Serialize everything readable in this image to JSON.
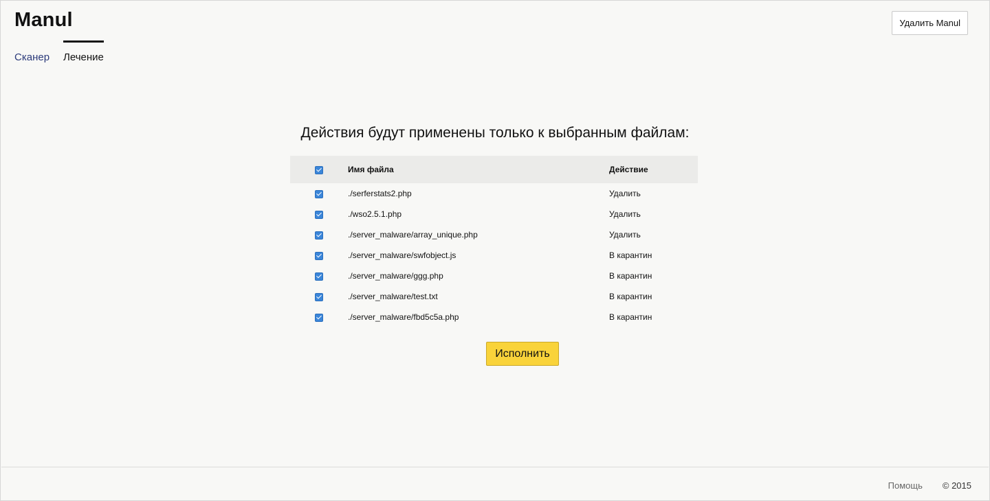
{
  "header": {
    "app_title": "Manul",
    "delete_app_label": "Удалить Manul"
  },
  "tabs": [
    {
      "label": "Сканер",
      "active": false
    },
    {
      "label": "Лечение",
      "active": true
    }
  ],
  "main": {
    "heading": "Действия будут применены только к выбранным файлам:",
    "table": {
      "columns": [
        "Имя файла",
        "Действие"
      ],
      "header_checked": true,
      "rows": [
        {
          "checked": true,
          "file": "./serferstats2.php",
          "action": "Удалить"
        },
        {
          "checked": true,
          "file": "./wso2.5.1.php",
          "action": "Удалить"
        },
        {
          "checked": true,
          "file": "./server_malware/array_unique.php",
          "action": "Удалить"
        },
        {
          "checked": true,
          "file": "./server_malware/swfobject.js",
          "action": "В карантин"
        },
        {
          "checked": true,
          "file": "./server_malware/ggg.php",
          "action": "В карантин"
        },
        {
          "checked": true,
          "file": "./server_malware/test.txt",
          "action": "В карантин"
        },
        {
          "checked": true,
          "file": "./server_malware/fbd5c5a.php",
          "action": "В карантин"
        }
      ]
    },
    "execute_label": "Исполнить"
  },
  "footer": {
    "help_label": "Помощь",
    "copyright": "© 2015"
  },
  "colors": {
    "background": "#f8f8f6",
    "accent_button": "#f9d33a",
    "checkbox": "#3b86d9",
    "link": "#2b3a7a"
  }
}
